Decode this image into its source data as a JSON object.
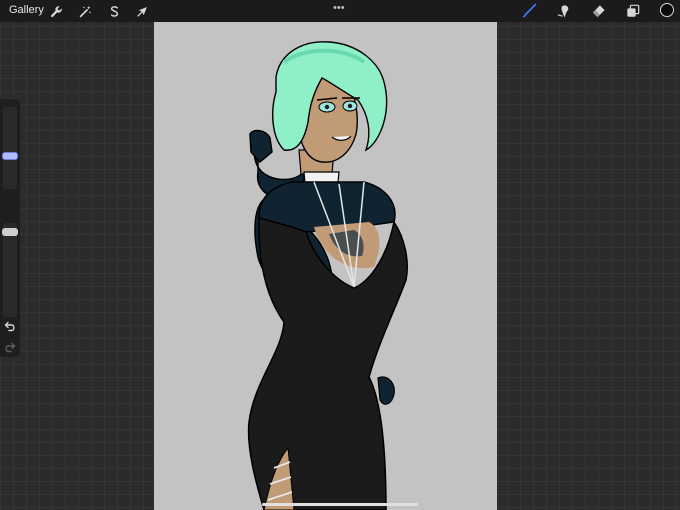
{
  "topbar": {
    "gallery_label": "Gallery",
    "more_label": "•••",
    "left_tools": [
      "wrench-icon",
      "magic-wand-icon",
      "selection-icon",
      "transform-arrow-icon"
    ],
    "right_tools": [
      "brush-icon",
      "smudge-icon",
      "eraser-icon",
      "layers-icon"
    ],
    "active_tool": "brush-icon",
    "active_tool_color": "#3d7bff",
    "current_color": "#0a0a0a"
  },
  "sidebar": {
    "brush_size_level": 0.45,
    "opacity_level": 0.9,
    "modify_icon": "square-icon",
    "undo_icon": "undo-icon",
    "redo_icon": "redo-icon"
  },
  "canvas": {
    "background_color": "#c3c3c3",
    "content": "illustration"
  }
}
